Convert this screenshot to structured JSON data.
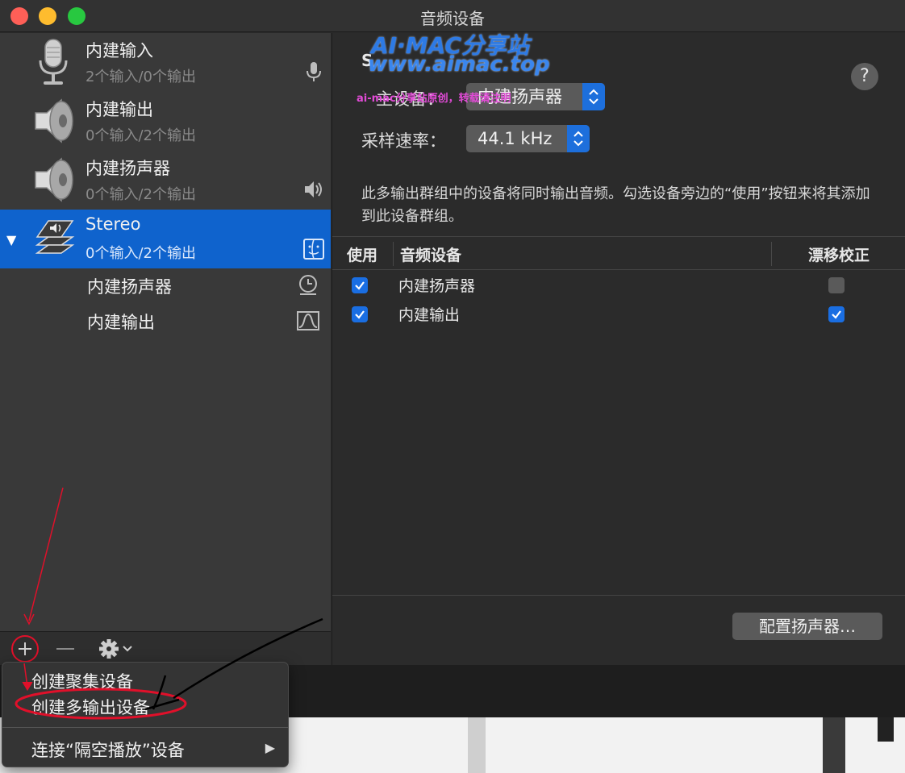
{
  "window": {
    "title": "音频设备"
  },
  "watermark": {
    "line1": "AI·MAC分享站",
    "line2": "www.aimac.top",
    "line3": "ai-mac分享站原创，转载请注明"
  },
  "sidebar": {
    "devices": [
      {
        "name": "内建输入",
        "io": "2个输入/0个输出",
        "icon": "microphone-icon",
        "right_icon": "microphone-small-icon"
      },
      {
        "name": "内建输出",
        "io": "0个输入/2个输出",
        "icon": "speaker-icon"
      },
      {
        "name": "内建扬声器",
        "io": "0个输入/2个输出",
        "icon": "speaker-icon",
        "right_icon": "volume-icon"
      },
      {
        "name": "Stereo",
        "io": "0个输入/2个输出",
        "icon": "multi-output-icon",
        "right_icon": "finder-icon",
        "selected": true,
        "children": [
          {
            "name": "内建扬声器",
            "right_icon": "clock-icon"
          },
          {
            "name": "内建输出",
            "right_icon": "waveform-icon"
          }
        ]
      }
    ],
    "toolbar": {
      "add": "+",
      "remove": "—"
    }
  },
  "main": {
    "header": "S",
    "master_device_label": "主设备：",
    "master_device_value": "内建扬声器",
    "sample_rate_label": "采样速率：",
    "sample_rate_value": "44.1 kHz",
    "help": "?",
    "description": "此多输出群组中的设备将同时输出音频。勾选设备旁边的“使用”按钮来将其添加到此设备群组。",
    "table": {
      "columns": [
        "使用",
        "音频设备",
        "漂移校正"
      ],
      "rows": [
        {
          "use": true,
          "device": "内建扬声器",
          "drift": false
        },
        {
          "use": true,
          "device": "内建输出",
          "drift": true
        }
      ]
    },
    "config_button": "配置扬声器…"
  },
  "add_menu": {
    "items": [
      "创建聚集设备",
      "创建多输出设备",
      "连接“隔空播放”设备"
    ]
  },
  "colors": {
    "accent": "#0f63cd",
    "annotation_red": "#e0102a",
    "checkbox_blue": "#1a6ee2"
  }
}
